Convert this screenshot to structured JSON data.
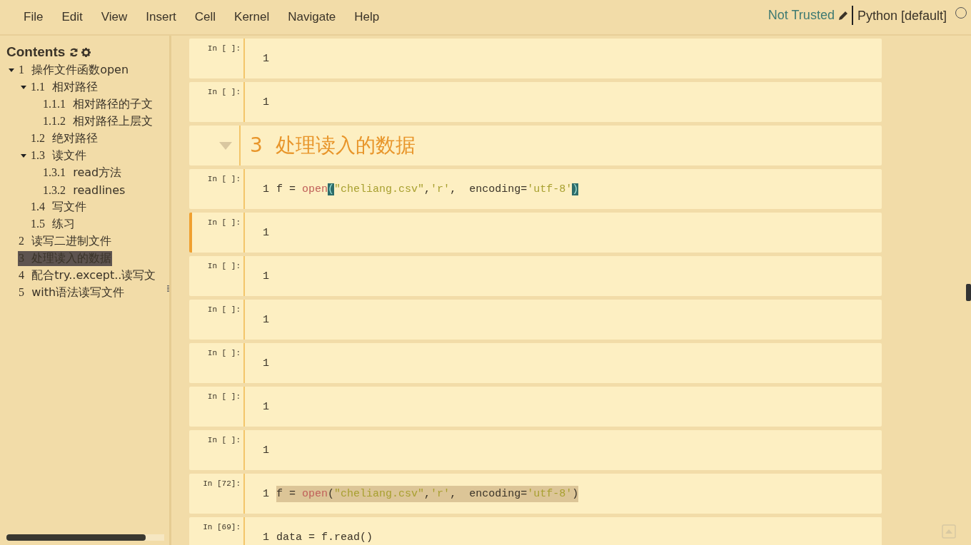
{
  "menu": [
    "File",
    "Edit",
    "View",
    "Insert",
    "Cell",
    "Kernel",
    "Navigate",
    "Help"
  ],
  "status": {
    "trust": "Not Trusted",
    "kernel": "Python [default]",
    "kernel_busy": false
  },
  "toc": {
    "title": "Contents",
    "items": [
      {
        "number": "1",
        "title": "操作文件函数open",
        "selected": false,
        "expanded": true,
        "children": [
          {
            "number": "1.1",
            "title": "相对路径",
            "selected": false,
            "expanded": true,
            "children": [
              {
                "number": "1.1.1",
                "title": "相对路径的子文",
                "selected": false
              },
              {
                "number": "1.1.2",
                "title": "相对路径上层文",
                "selected": false
              }
            ]
          },
          {
            "number": "1.2",
            "title": "绝对路径",
            "selected": false
          },
          {
            "number": "1.3",
            "title": "读文件",
            "selected": false,
            "expanded": true,
            "children": [
              {
                "number": "1.3.1",
                "title": "read方法",
                "selected": false
              },
              {
                "number": "1.3.2",
                "title": "readlines",
                "selected": false
              }
            ]
          },
          {
            "number": "1.4",
            "title": "写文件",
            "selected": false
          },
          {
            "number": "1.5",
            "title": "练习",
            "selected": false
          }
        ]
      },
      {
        "number": "2",
        "title": "读写二进制文件",
        "selected": false
      },
      {
        "number": "3",
        "title": "处理读入的数据",
        "selected": true
      },
      {
        "number": "4",
        "title": "配合try..except..读写文",
        "selected": false
      },
      {
        "number": "5",
        "title": "with语法读写文件",
        "selected": false
      }
    ]
  },
  "cells": [
    {
      "kind": "code",
      "prompt": "In [ ]:",
      "line": "1",
      "selected": false
    },
    {
      "kind": "code",
      "prompt": "In [ ]:",
      "line": "1",
      "selected": false
    },
    {
      "kind": "heading",
      "number": "3",
      "text": "处理读入的数据",
      "selected": false
    },
    {
      "kind": "code",
      "prompt": "In [ ]:",
      "line": "1",
      "selected": false,
      "highlighted": false,
      "tokens": [
        {
          "text": "f = ",
          "kind": "plain"
        },
        {
          "text": "open",
          "kind": "builtin"
        },
        {
          "text": "(",
          "kind": "match"
        },
        {
          "text": "\"cheliang.csv\"",
          "kind": "string"
        },
        {
          "text": ",",
          "kind": "plain"
        },
        {
          "text": "'r'",
          "kind": "string"
        },
        {
          "text": ",  encoding=",
          "kind": "plain"
        },
        {
          "text": "'utf-8'",
          "kind": "string"
        },
        {
          "text": ")",
          "kind": "match"
        }
      ]
    },
    {
      "kind": "code",
      "prompt": "In [ ]:",
      "line": "1",
      "selected": true
    },
    {
      "kind": "code",
      "prompt": "In [ ]:",
      "line": "1",
      "selected": false
    },
    {
      "kind": "code",
      "prompt": "In [ ]:",
      "line": "1",
      "selected": false
    },
    {
      "kind": "code",
      "prompt": "In [ ]:",
      "line": "1",
      "selected": false
    },
    {
      "kind": "code",
      "prompt": "In [ ]:",
      "line": "1",
      "selected": false
    },
    {
      "kind": "code",
      "prompt": "In [ ]:",
      "line": "1",
      "selected": false
    },
    {
      "kind": "code",
      "prompt": "In [72]:",
      "line": "1",
      "selected": false,
      "highlighted": true,
      "tokens": [
        {
          "text": "f = ",
          "kind": "plain"
        },
        {
          "text": "open",
          "kind": "builtin"
        },
        {
          "text": "(",
          "kind": "plain"
        },
        {
          "text": "\"cheliang.csv\"",
          "kind": "string"
        },
        {
          "text": ",",
          "kind": "plain"
        },
        {
          "text": "'r'",
          "kind": "string"
        },
        {
          "text": ",  encoding=",
          "kind": "plain"
        },
        {
          "text": "'utf-8'",
          "kind": "string"
        },
        {
          "text": ")",
          "kind": "plain"
        }
      ]
    },
    {
      "kind": "code",
      "prompt": "In [69]:",
      "line": "1",
      "selected": false,
      "highlighted": false,
      "tokens": [
        {
          "text": "data = f.read()",
          "kind": "plain"
        }
      ]
    }
  ]
}
